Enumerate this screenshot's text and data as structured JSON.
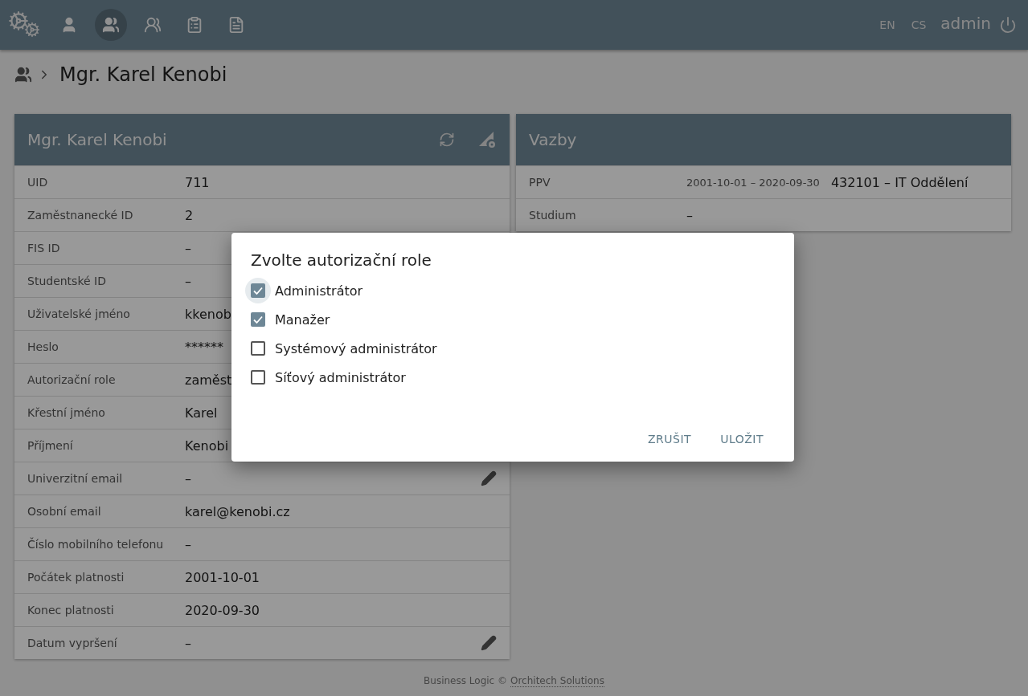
{
  "topbar": {
    "nav": [
      {
        "kind": "person",
        "selected": false
      },
      {
        "kind": "people",
        "selected": true
      },
      {
        "kind": "groups",
        "selected": false
      },
      {
        "kind": "clipboard",
        "selected": false
      },
      {
        "kind": "document",
        "selected": false
      }
    ],
    "languages": [
      "EN",
      "CS"
    ],
    "user": "admin"
  },
  "breadcrumb": {
    "title": "Mgr. Karel Kenobi"
  },
  "person_card": {
    "title": "Mgr. Karel Kenobi",
    "rows": [
      {
        "label": "UID",
        "value": "711",
        "editable": false
      },
      {
        "label": "Zaměstnanecké ID",
        "value": "2",
        "editable": false
      },
      {
        "label": "FIS ID",
        "value": "–"
      },
      {
        "label": "Studentské ID",
        "value": "–"
      },
      {
        "label": "Uživatelské jméno",
        "value": "kkenob"
      },
      {
        "label": "Heslo",
        "value": "******"
      },
      {
        "label": "Autorizační role",
        "value": "zaměst"
      },
      {
        "label": "Křestní jméno",
        "value": "Karel"
      },
      {
        "label": "Příjmení",
        "value": "Kenobi"
      },
      {
        "label": "Univerzitní email",
        "value": "–",
        "editable": true
      },
      {
        "label": "Osobní email",
        "value": "karel@kenobi.cz",
        "editable": false
      },
      {
        "label": "Číslo mobilního telefonu",
        "value": "–",
        "editable": false
      },
      {
        "label": "Počátek platnosti",
        "value": "2001-10-01",
        "editable": false
      },
      {
        "label": "Konec platnosti",
        "value": "2020-09-30",
        "editable": false
      },
      {
        "label": "Datum vypršení",
        "value": "–",
        "editable": true
      }
    ]
  },
  "relations_card": {
    "title": "Vazby",
    "rows": [
      {
        "label": "PPV",
        "period": "2001-10-01 – 2020-09-30",
        "value": "432101 – IT Oddělení"
      },
      {
        "label": "Studium",
        "value": "–"
      }
    ]
  },
  "dialog": {
    "title": "Zvolte autorizační role",
    "roles": [
      {
        "label": "Administrátor",
        "checked": true,
        "focused": true
      },
      {
        "label": "Manažer",
        "checked": true,
        "focused": false
      },
      {
        "label": "Systémový administrátor",
        "checked": false,
        "focused": false
      },
      {
        "label": "Síťový administrátor",
        "checked": false,
        "focused": false
      }
    ],
    "buttons": [
      "ZRUŠIT",
      "ULOŽIT"
    ]
  },
  "footer": {
    "text": "Business Logic ©",
    "link": "Orchitech Solutions"
  }
}
